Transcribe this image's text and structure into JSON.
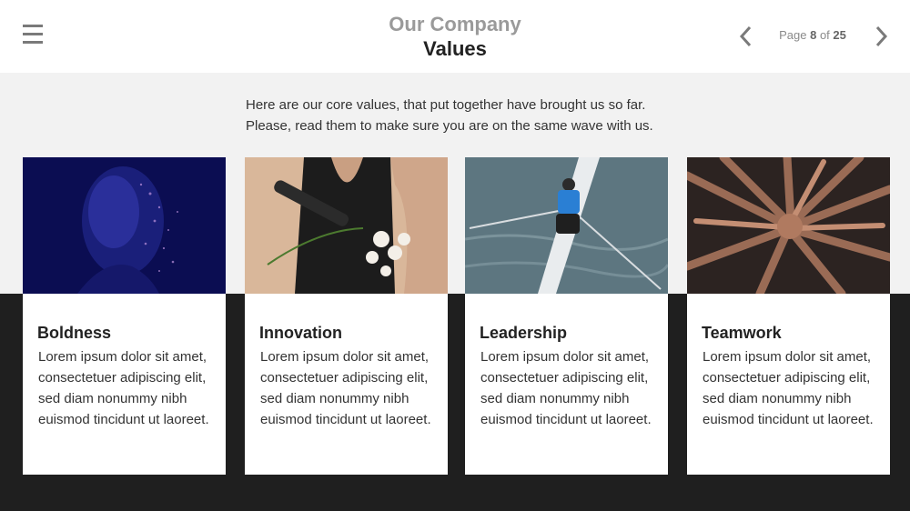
{
  "header": {
    "title_line1": "Our Company",
    "title_line2": "Values",
    "page_label": "Page",
    "page_current": "8",
    "page_of": "of",
    "page_total": "25"
  },
  "intro": {
    "line1": "Here are our core values, that put together have brought us so far.",
    "line2": "Please, read them to make sure you are on the same wave with us."
  },
  "cards": [
    {
      "title": "Boldness",
      "text": "Lorem ipsum dolor sit amet, consectetuer adipiscing elit, sed diam nonummy nibh euismod tincidunt ut laoreet.",
      "image": "portrait-with-glitter-photo"
    },
    {
      "title": "Innovation",
      "text": "Lorem ipsum dolor sit amet, consectetuer adipiscing elit, sed diam nonummy nibh euismod tincidunt ut laoreet.",
      "image": "prosthetic-arm-flowers-photo"
    },
    {
      "title": "Leadership",
      "text": "Lorem ipsum dolor sit amet, consectetuer adipiscing elit, sed diam nonummy nibh euismod tincidunt ut laoreet.",
      "image": "rower-on-water-photo"
    },
    {
      "title": "Teamwork",
      "text": "Lorem ipsum dolor sit amet, consectetuer adipiscing elit, sed diam nonummy nibh euismod tincidunt ut laoreet.",
      "image": "stacked-hands-photo"
    }
  ],
  "icons": {
    "menu": "hamburger-menu-icon",
    "prev": "chevron-left-icon",
    "next": "chevron-right-icon"
  },
  "colors": {
    "header_bg": "#ffffff",
    "page_bg": "#f2f2f2",
    "dark_band": "#1f1f1f",
    "title_muted": "#9a9a9a",
    "title_dark": "#222222"
  }
}
